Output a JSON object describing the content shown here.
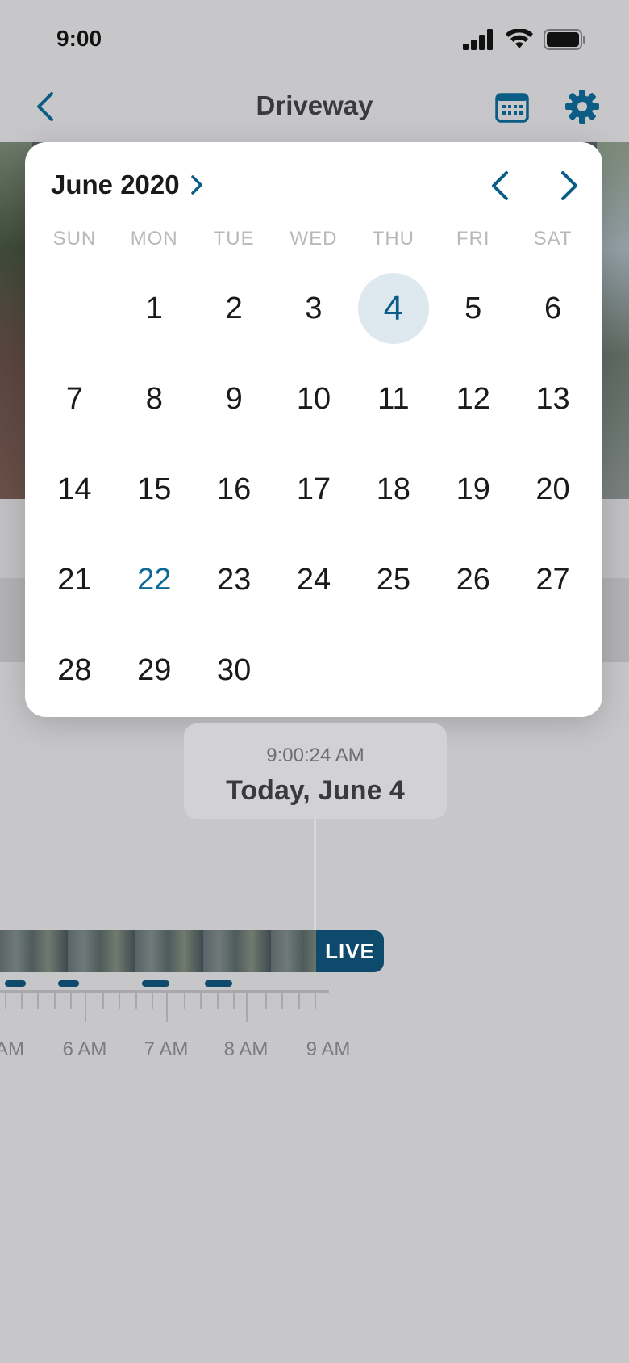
{
  "status_bar": {
    "time": "9:00"
  },
  "nav": {
    "title": "Driveway"
  },
  "calendar": {
    "month_label": "June 2020",
    "weekdays": [
      "SUN",
      "MON",
      "TUE",
      "WED",
      "THU",
      "FRI",
      "SAT"
    ],
    "days": [
      "",
      "1",
      "2",
      "3",
      "4",
      "5",
      "6",
      "7",
      "8",
      "9",
      "10",
      "11",
      "12",
      "13",
      "14",
      "15",
      "16",
      "17",
      "18",
      "19",
      "20",
      "21",
      "22",
      "23",
      "24",
      "25",
      "26",
      "27",
      "28",
      "29",
      "30",
      "",
      "",
      "",
      ""
    ],
    "selected_day": "4",
    "highlighted_day": "22"
  },
  "time_indicator": {
    "time": "9:00:24 AM",
    "date": "Today, June 4"
  },
  "timeline": {
    "live_label": "LIVE",
    "time_labels": [
      "AM",
      "6 AM",
      "7 AM",
      "8 AM",
      "9 AM"
    ]
  },
  "colors": {
    "accent": "#0b5d85",
    "live_bg": "#0d4a6b",
    "selected_bg": "#dde9ee"
  },
  "icons": [
    "back-chevron-icon",
    "calendar-icon",
    "gear-icon",
    "signal-icon",
    "wifi-icon",
    "battery-icon",
    "chevron-right-icon",
    "chevron-left-icon"
  ]
}
